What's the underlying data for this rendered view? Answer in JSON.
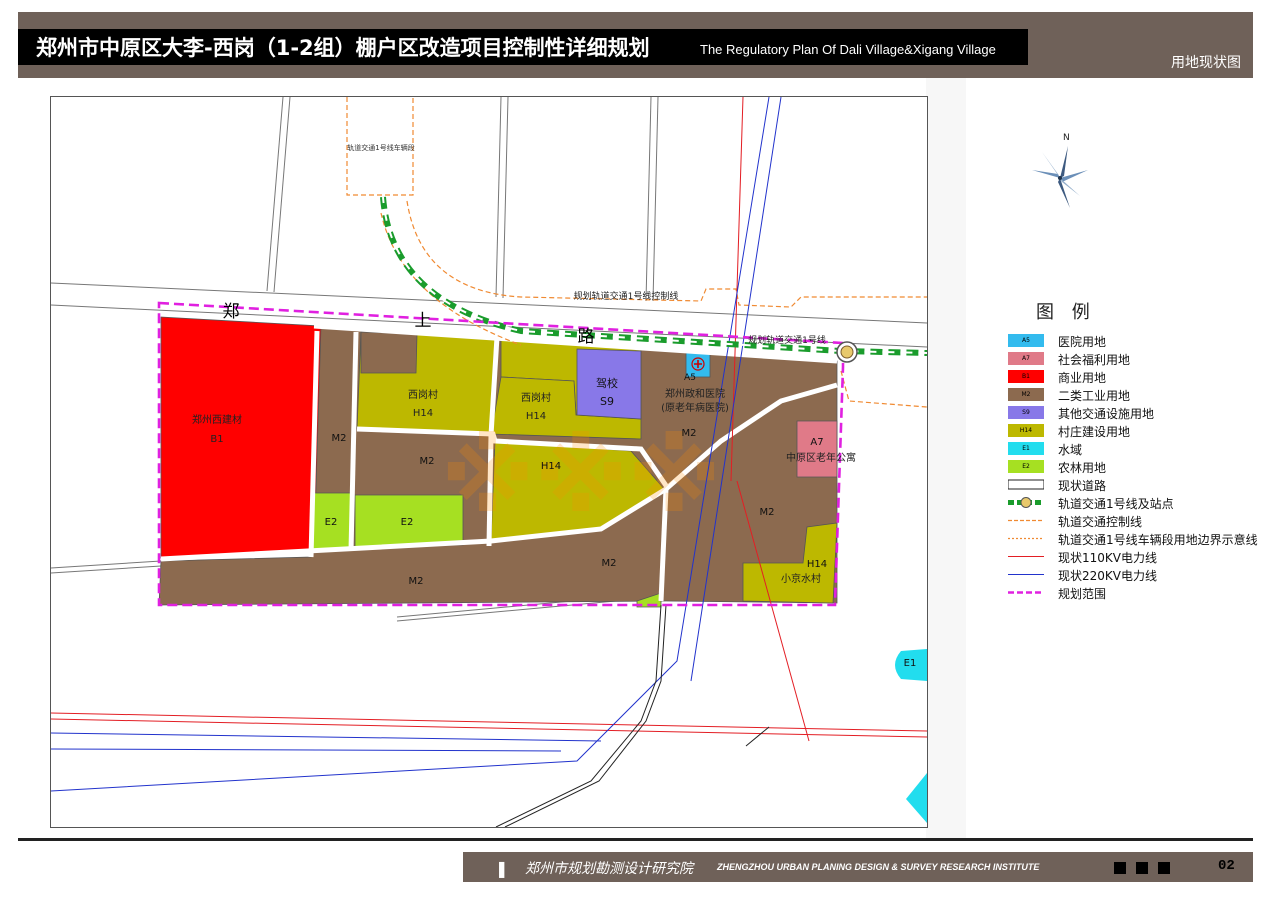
{
  "header": {
    "title_cn": "郑州市中原区大李-西岗（1-2组）棚户区改造项目控制性详细规划",
    "title_en": "The Regulatory Plan Of Dali Village&Xigang Village",
    "map_type": "用地现状图"
  },
  "compass": {
    "north_label": "N"
  },
  "map": {
    "road_chars": [
      "郑",
      "上",
      "路"
    ],
    "line_labels": {
      "depot": "轨道交通1号线车辆段",
      "control_line": "规划轨道交通1号线控制线",
      "metro_line": "规划轨道交通1号线"
    },
    "parcels": {
      "b1": {
        "name": "郑州西建材",
        "code": "B1"
      },
      "xigang1": {
        "name": "西岗村",
        "code": "H14"
      },
      "xigang2": {
        "name": "西岗村",
        "code": "H14"
      },
      "driving": {
        "name": "驾校",
        "code": "S9"
      },
      "hospital_name": "郑州政和医院",
      "hospital_sub": "(原老年病医院)",
      "a5": "A5",
      "a7": {
        "code": "A7",
        "name": "中原区老年公寓"
      },
      "m2": "M2",
      "h14": "H14",
      "e2": "E2",
      "xiaojing": {
        "code": "H14",
        "name": "小京水村"
      },
      "e1": "E1"
    }
  },
  "legend": {
    "title": "图 例",
    "items": [
      {
        "code": "A5",
        "label": "医院用地",
        "color": "#33bbee"
      },
      {
        "code": "A7",
        "label": "社会福利用地",
        "color": "#e07a88"
      },
      {
        "code": "B1",
        "label": "商业用地",
        "color": "#ff0000"
      },
      {
        "code": "M2",
        "label": "二类工业用地",
        "color": "#8c6a4f"
      },
      {
        "code": "S9",
        "label": "其他交通设施用地",
        "color": "#8878e8"
      },
      {
        "code": "H14",
        "label": "村庄建设用地",
        "color": "#bdb800"
      },
      {
        "code": "E1",
        "label": "水域",
        "color": "#22ddee"
      },
      {
        "code": "E2",
        "label": "农林用地",
        "color": "#a6e022"
      },
      {
        "code": "",
        "label": "现状道路",
        "type": "road"
      },
      {
        "code": "",
        "label": "轨道交通1号线及站点",
        "type": "metro"
      },
      {
        "code": "",
        "label": "轨道交通控制线",
        "type": "control"
      },
      {
        "code": "",
        "label": "轨道交通1号线车辆段用地边界示意线",
        "type": "depot"
      },
      {
        "code": "",
        "label": "现状110KV电力线",
        "type": "kv110"
      },
      {
        "code": "",
        "label": "现状220KV电力线",
        "type": "kv220"
      },
      {
        "code": "",
        "label": "规划范围",
        "type": "boundary"
      }
    ]
  },
  "footer": {
    "institute_cn": "郑州市规划勘测设计研究院",
    "institute_en": "ZHENGZHOU URBAN PLANING DESIGN & SURVEY RESEARCH INSTITUTE",
    "page": "02"
  }
}
